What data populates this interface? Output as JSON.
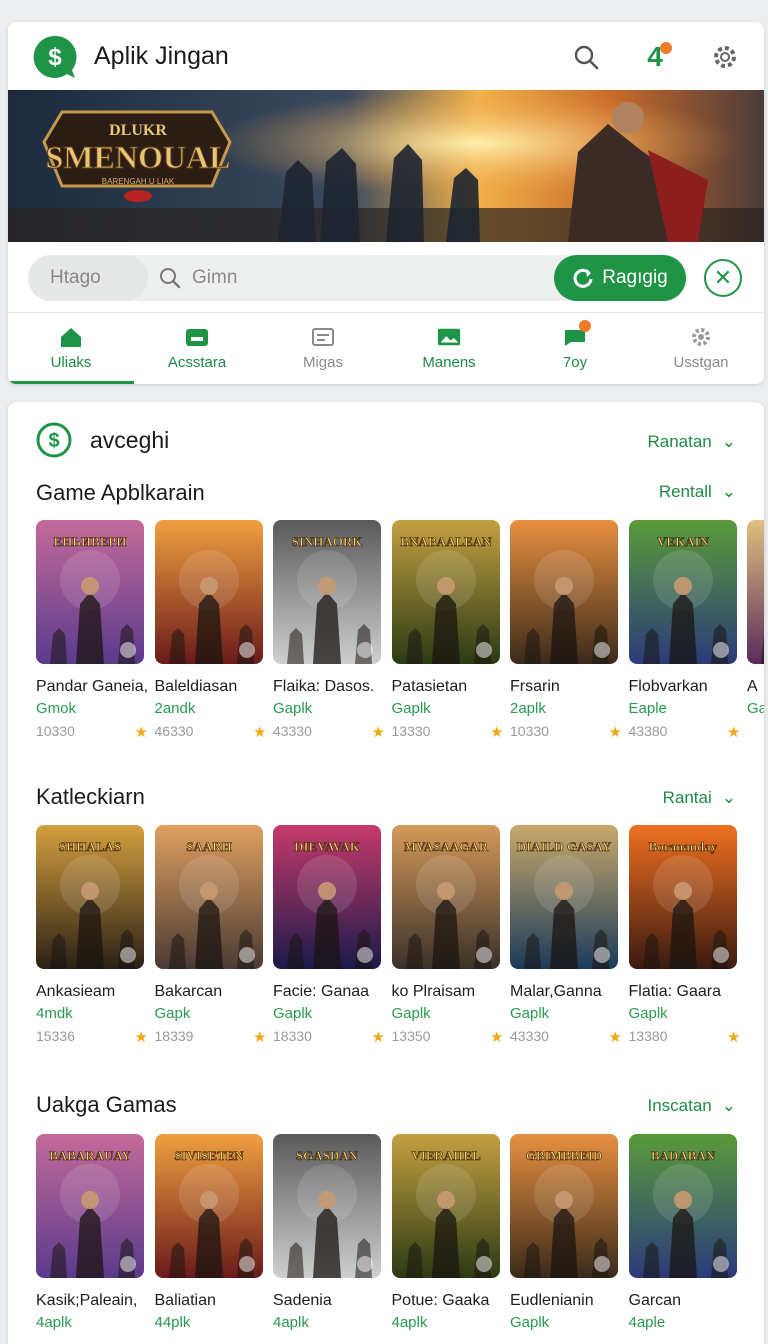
{
  "app": {
    "title": "Aplik Jingan",
    "badge": "4",
    "accent": "#1f9447"
  },
  "banner": {
    "title": "SMENOUAL",
    "top": "DLUKR",
    "sub": "BARENGAH U LIAK"
  },
  "search": {
    "segment": "Htago",
    "placeholder": "Gimn",
    "button": "Ragıgig"
  },
  "tabs": [
    {
      "label": "Uliaks",
      "icon": "home-icon"
    },
    {
      "label": "Acsstara",
      "icon": "wallet-icon"
    },
    {
      "label": "Migas",
      "icon": "window-icon"
    },
    {
      "label": "Manens",
      "icon": "image-icon"
    },
    {
      "label": "7oy",
      "icon": "notify-icon"
    },
    {
      "label": "Usstgan",
      "icon": "gear-icon"
    }
  ],
  "profile": {
    "name": "avceghi",
    "link": "Ranatan"
  },
  "sections": [
    {
      "title": "Game Apblkarain",
      "link": "Rentall",
      "items": [
        {
          "name": "Pandar Ganeia,",
          "sub": "Gmok",
          "count": "10330",
          "art": "ЕНЬИВЕРИ"
        },
        {
          "name": "Baleldiasan",
          "sub": "2andk",
          "count": "46330",
          "art": ""
        },
        {
          "name": "Flaika: Dasos.",
          "sub": "Gaplk",
          "count": "43330",
          "art": "SINHAORK"
        },
        {
          "name": "Patasietan",
          "sub": "Gaplk",
          "count": "13330",
          "art": "BNABAALEAN"
        },
        {
          "name": "Frsarin",
          "sub": "2aplk",
          "count": "10330",
          "art": ""
        },
        {
          "name": "Flobvarkan",
          "sub": "Eaple",
          "count": "43380",
          "art": "VEKAIN"
        },
        {
          "name": "A",
          "sub": "Ga",
          "count": "",
          "art": ""
        }
      ]
    },
    {
      "title": "Katleckiarn",
      "link": "Rantai",
      "items": [
        {
          "name": "Ankasieam",
          "sub": "4mdk",
          "count": "15336",
          "art": "SHHALAS"
        },
        {
          "name": "Bakarcan",
          "sub": "Gapk",
          "count": "18339",
          "art": "SAARH"
        },
        {
          "name": "Facie: Ganaa",
          "sub": "Gaplk",
          "count": "18330",
          "art": "DIEVAVAK"
        },
        {
          "name": "ko Plraisam",
          "sub": "Gaplk",
          "count": "13350",
          "art": "MVASAAGAR"
        },
        {
          "name": "Malar,Ganna",
          "sub": "Gaplk",
          "count": "43330",
          "art": "DIAILD GASAY"
        },
        {
          "name": "Flatia: Gaara",
          "sub": "Gaplk",
          "count": "13380",
          "art": "Boranauday"
        }
      ]
    },
    {
      "title": "Uakga Gamas",
      "link": "Inscatan",
      "items": [
        {
          "name": "Kasik;Paleain,",
          "sub": "4aplk",
          "count": "",
          "art": "BABARAUAY"
        },
        {
          "name": "Baliatian",
          "sub": "44plk",
          "count": "",
          "art": "SIVISETEN"
        },
        {
          "name": "Sadenia",
          "sub": "4aplk",
          "count": "",
          "art": "SGASDAN"
        },
        {
          "name": "Potue: Gaaka",
          "sub": "4aplk",
          "count": "",
          "art": "VIERAIIEL"
        },
        {
          "name": "Eudlenianin",
          "sub": "Gaplk",
          "count": "",
          "art": "GBIMBBEID"
        },
        {
          "name": "Garcan",
          "sub": "4aple",
          "count": "",
          "art": "BADABAN"
        }
      ]
    }
  ]
}
